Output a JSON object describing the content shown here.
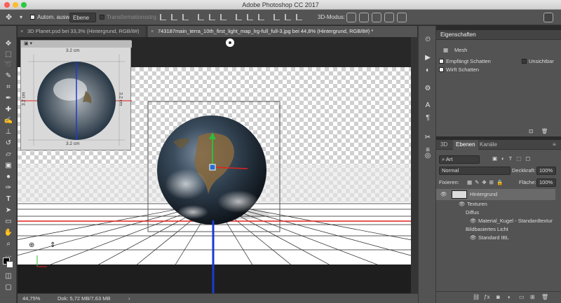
{
  "window": {
    "title": "Adobe Photoshop CC 2017"
  },
  "options_bar": {
    "auto_select_label": "Autom. ausw.:",
    "auto_select_value": "Ebene",
    "transform_controls_label": "Transformationsstrg.",
    "mode_3d_label": "3D-Modus:"
  },
  "tabs": [
    {
      "label": "3D Planet.psd bei 33,3% (Hintergrund, RGB/8#)"
    },
    {
      "label": "743187main_terra_10th_first_light_map_lrg-full_full-3.jpg bei 44,8% (Hintergrund, RGB/8#) *"
    }
  ],
  "canvas": {
    "ruler_top_label": "3.2 cm",
    "ruler_bottom_label": "3.2 cm",
    "ruler_left_label": "3.2 cm",
    "ruler_right_label": "3.2 cm"
  },
  "statusbar": {
    "zoom": "44,75%",
    "doc_info": "Dok: 5,72 MB/7,63 MB"
  },
  "properties": {
    "title": "Eigenschaften",
    "mesh_label": "Mesh",
    "receive_shadows": "Empfängt Schatten",
    "invisible": "Unsichtbar",
    "cast_shadows": "Wirft Schatten"
  },
  "layers_panel": {
    "tabs": [
      "3D",
      "Ebenen",
      "Kanäle"
    ],
    "active_tab": "Ebenen",
    "filter_kind": "Art",
    "blend_mode": "Normal",
    "opacity_label": "Deckkraft:",
    "opacity_value": "100%",
    "lock_label": "Fixieren:",
    "fill_label": "Fläche:",
    "fill_value": "100%",
    "layers": [
      {
        "label": "Hintergrund"
      },
      {
        "label": "Texturen"
      },
      {
        "label": "Diffus"
      },
      {
        "label": "Material_Kugel - Standardtextur"
      },
      {
        "label": "Bildbasiertes Licht"
      },
      {
        "label": "Standard IBL"
      }
    ]
  },
  "colors": {
    "accent": "#1f6fd6",
    "guide_red": "#e0221d",
    "axis_blue": "#1a3bd1",
    "axis_green": "#2fbd3a"
  }
}
